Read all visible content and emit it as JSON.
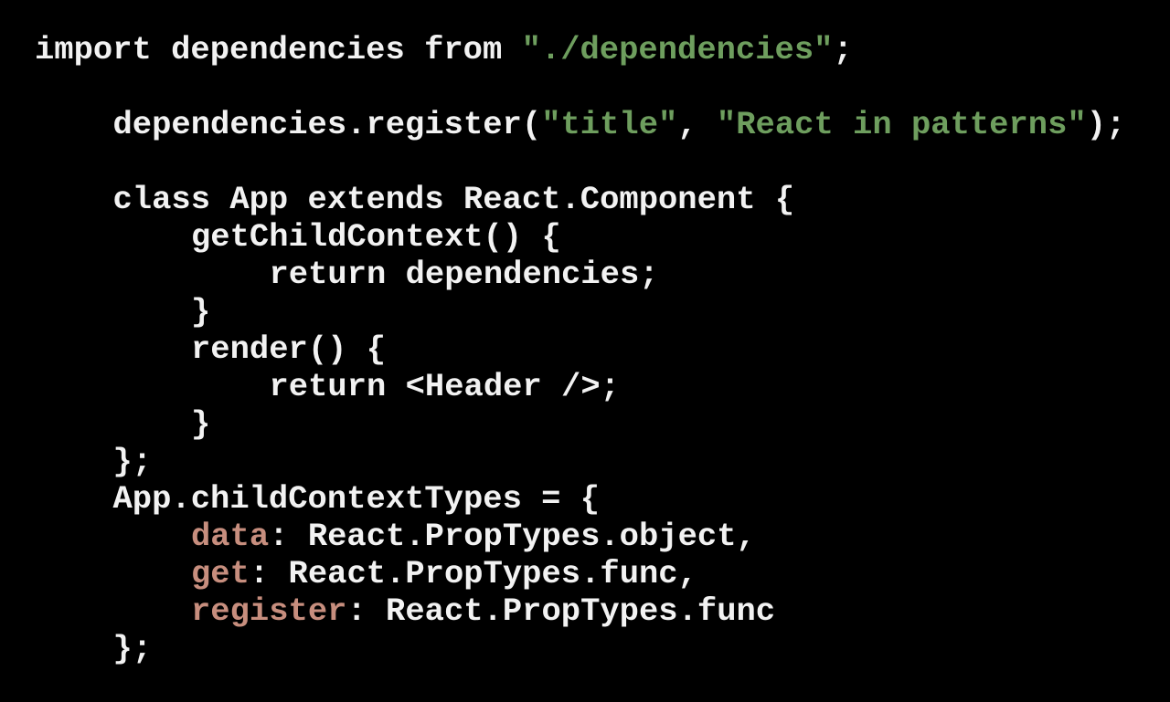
{
  "code": {
    "lines": [
      {
        "indent": 0,
        "tokens": [
          {
            "text": "import dependencies from ",
            "kind": "plain"
          },
          {
            "text": "\"./dependencies\"",
            "kind": "string"
          },
          {
            "text": ";",
            "kind": "plain"
          }
        ]
      },
      {
        "indent": 0,
        "blank": true,
        "tokens": []
      },
      {
        "indent": 1,
        "tokens": [
          {
            "text": "dependencies.register(",
            "kind": "plain"
          },
          {
            "text": "\"title\"",
            "kind": "string"
          },
          {
            "text": ", ",
            "kind": "plain"
          },
          {
            "text": "\"React in patterns\"",
            "kind": "string"
          },
          {
            "text": ");",
            "kind": "plain"
          }
        ]
      },
      {
        "indent": 0,
        "blank": true,
        "tokens": []
      },
      {
        "indent": 1,
        "tokens": [
          {
            "text": "class App extends React.Component {",
            "kind": "plain"
          }
        ]
      },
      {
        "indent": 2,
        "tokens": [
          {
            "text": "getChildContext() {",
            "kind": "plain"
          }
        ]
      },
      {
        "indent": 3,
        "tokens": [
          {
            "text": "return dependencies;",
            "kind": "plain"
          }
        ]
      },
      {
        "indent": 2,
        "tokens": [
          {
            "text": "}",
            "kind": "plain"
          }
        ]
      },
      {
        "indent": 2,
        "tokens": [
          {
            "text": "render() {",
            "kind": "plain"
          }
        ]
      },
      {
        "indent": 3,
        "tokens": [
          {
            "text": "return <Header />;",
            "kind": "plain"
          }
        ]
      },
      {
        "indent": 2,
        "tokens": [
          {
            "text": "}",
            "kind": "plain"
          }
        ]
      },
      {
        "indent": 1,
        "tokens": [
          {
            "text": "};",
            "kind": "plain"
          }
        ]
      },
      {
        "indent": 1,
        "tokens": [
          {
            "text": "App.childContextTypes = {",
            "kind": "plain"
          }
        ]
      },
      {
        "indent": 2,
        "tokens": [
          {
            "text": "data",
            "kind": "key"
          },
          {
            "text": ": React.PropTypes.object,",
            "kind": "plain"
          }
        ]
      },
      {
        "indent": 2,
        "tokens": [
          {
            "text": "get",
            "kind": "key"
          },
          {
            "text": ": React.PropTypes.func,",
            "kind": "plain"
          }
        ]
      },
      {
        "indent": 2,
        "tokens": [
          {
            "text": "register",
            "kind": "key"
          },
          {
            "text": ": React.PropTypes.func",
            "kind": "plain"
          }
        ]
      },
      {
        "indent": 1,
        "tokens": [
          {
            "text": "};",
            "kind": "plain"
          }
        ]
      }
    ]
  },
  "colors": {
    "background": "#000000",
    "text": "#f2f2f2",
    "string": "#6e9e5e",
    "key": "#c78e7e"
  }
}
